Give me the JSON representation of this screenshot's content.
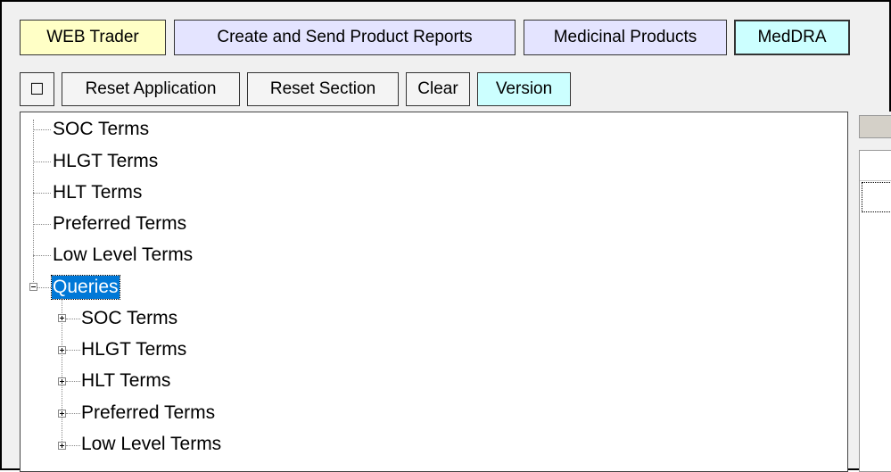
{
  "tabs": {
    "web_trader": "WEB Trader",
    "create_send": "Create and Send Product Reports",
    "medicinal": "Medicinal Products",
    "meddra": "MedDRA"
  },
  "toolbar": {
    "maximize_glyph": "☐",
    "reset_application": "Reset Application",
    "reset_section": "Reset Section",
    "clear": "Clear",
    "version": "Version"
  },
  "tree": {
    "top_items": [
      "SOC Terms",
      "HLGT Terms",
      "HLT Terms",
      "Preferred Terms",
      "Low Level Terms"
    ],
    "queries": {
      "label": "Queries",
      "children": [
        "SOC Terms",
        "HLGT Terms",
        "HLT Terms",
        "Preferred Terms",
        "Low Level Terms"
      ]
    }
  },
  "colors": {
    "web_trader_bg": "#ffffc6",
    "create_send_bg": "#e4e4ff",
    "medicinal_bg": "#e4e4ff",
    "meddra_bg": "#ccffff",
    "version_bg": "#ccffff",
    "selection": "#0078d7"
  }
}
